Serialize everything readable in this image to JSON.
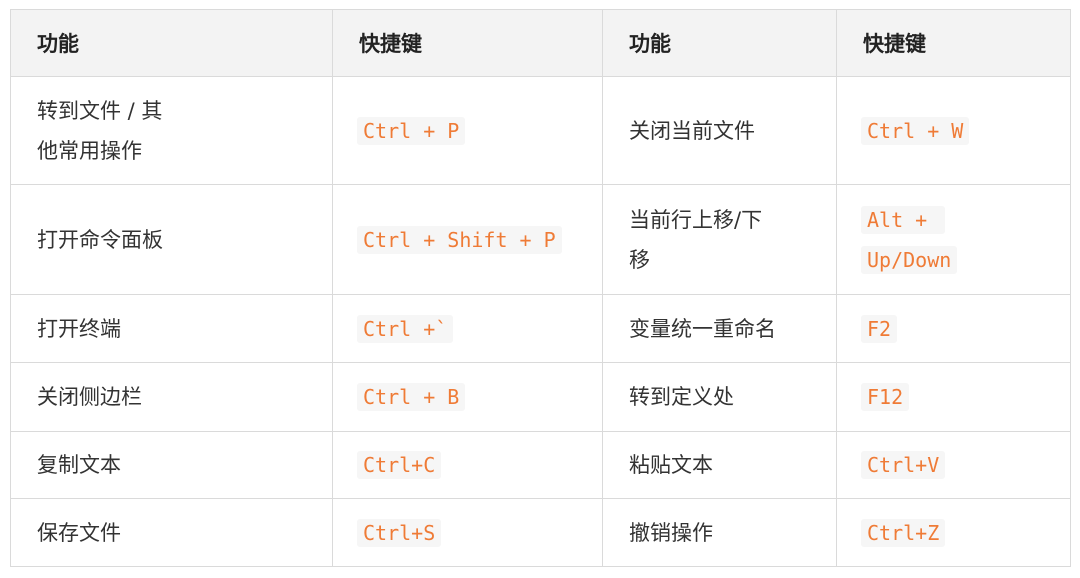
{
  "headers": [
    "功能",
    "快捷键",
    "功能",
    "快捷键"
  ],
  "rows": [
    {
      "func_left": "转到文件 / 其他常用操作",
      "key_left": "Ctrl + P",
      "func_right": "关闭当前文件",
      "key_right": "Ctrl + W"
    },
    {
      "func_left": "打开命令面板",
      "key_left": "Ctrl + Shift + P",
      "func_right": "当前行上移/下移",
      "key_right": "Alt + Up/Down"
    },
    {
      "func_left": "打开终端",
      "key_left": "Ctrl +`",
      "func_right": "变量统一重命名",
      "key_right": "F2"
    },
    {
      "func_left": "关闭侧边栏",
      "key_left": "Ctrl + B",
      "func_right": "转到定义处",
      "key_right": "F12"
    },
    {
      "func_left": "复制文本",
      "key_left": "Ctrl+C",
      "func_right": "粘贴文本",
      "key_right": "Ctrl+V"
    },
    {
      "func_left": "保存文件",
      "key_left": "Ctrl+S",
      "func_right": "撤销操作",
      "key_right": "Ctrl+Z"
    }
  ]
}
